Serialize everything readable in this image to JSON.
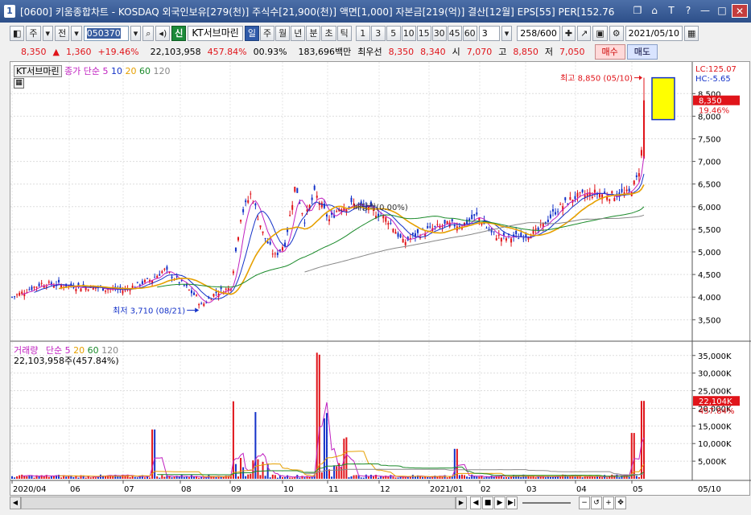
{
  "window": {
    "app_icon": "1",
    "title": "[0600] 키움종합차트 - KOSDAQ 외국인보유[279(천)] 주식수[21,900(천)] 액면[1,000] 자본금[219(억)] 결산[12월] EPS[55] PER[152.76"
  },
  "toolbar": {
    "chart_type": "주",
    "mode": "전",
    "stock_code": "050370",
    "stock_name": "KT서브마린",
    "green_btn": "신",
    "periods": [
      "일",
      "주",
      "월",
      "년",
      "분",
      "초",
      "틱"
    ],
    "selected_period": "일",
    "intervals": [
      "1",
      "3",
      "5",
      "10",
      "15",
      "30",
      "45",
      "60"
    ],
    "interval_value": "3",
    "count": "258",
    "count_total": "/600",
    "date": "2021/05/10"
  },
  "quote": {
    "price": "8,350",
    "change_arrow": "▲",
    "change": "1,360",
    "change_pct": "+19.46%",
    "volume": "22,103,958",
    "volume_pct": "457.84%",
    "turnover": "00.93%",
    "amount": "183,696백만",
    "bid_label": "최우선",
    "bid": "8,350",
    "ask": "8,340",
    "open_label": "시",
    "open": "7,070",
    "high_label": "고",
    "high": "8,850",
    "low_label": "저",
    "low": "7,050",
    "buy_label": "매수",
    "sell_label": "매도"
  },
  "price_panel": {
    "legend_name": "KT서브마린",
    "legend_prefix": "종가 단순",
    "ma": [
      "5",
      "10",
      "20",
      "60",
      "120"
    ],
    "lc": "LC:125.07",
    "hc": "HC:-5.65",
    "current_price": "8,350",
    "current_pct": "19.46%",
    "y_labels": [
      "8,500",
      "8,000",
      "7,500",
      "7,000",
      "6,500",
      "6,000",
      "5,500",
      "5,000",
      "4,500",
      "4,000",
      "3,500"
    ],
    "high_annotation": "최고 8,850 (05/10)",
    "low_annotation": "최저 3,710 (08/21)",
    "dividend_label": "배당락(0.00%)"
  },
  "volume_panel": {
    "legend_prefix": "거래량",
    "legend_ma_prefix": "단순",
    "ma": [
      "5",
      "20",
      "60",
      "120"
    ],
    "current_text": "22,103,958주(457.84%)",
    "current_label": "22,104K",
    "current_pct": "457.84%",
    "y_labels": [
      "35,000K",
      "30,000K",
      "25,000K",
      "20,000K",
      "15,000K",
      "10,000K",
      "5,000K"
    ]
  },
  "x_axis": {
    "labels": [
      "2020/04",
      "06",
      "07",
      "08",
      "09",
      "10",
      "11",
      "12",
      "2021/01",
      "02",
      "03",
      "04",
      "05"
    ],
    "right_label": "05/10"
  },
  "colors": {
    "up": "#e0141a",
    "down": "#1432c8",
    "ma5": "#c020c0",
    "ma10": "#1432c8",
    "ma20": "#e6a000",
    "ma60": "#1a8a2a",
    "ma120": "#888888"
  }
}
